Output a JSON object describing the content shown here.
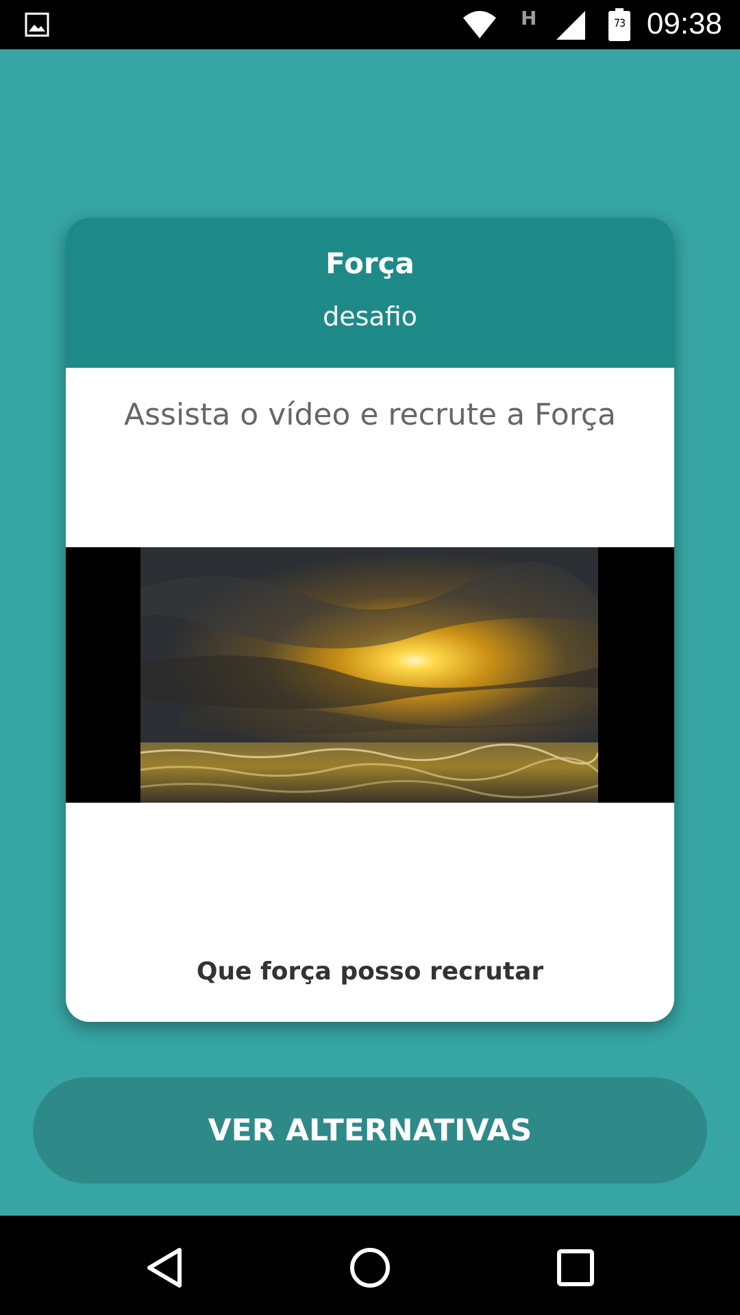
{
  "status_bar": {
    "time": "09:38",
    "battery_level": "73",
    "network_type": "H",
    "icons": [
      "gallery-icon",
      "wifi-icon",
      "cell-signal-icon",
      "battery-icon"
    ]
  },
  "card": {
    "title": "Força",
    "subtitle": "desafio",
    "instruction": "Assista o vídeo e recrute a Força",
    "question": "Que força posso recrutar",
    "video_thumbnail": "sunset-over-sea"
  },
  "actions": {
    "primary_button_label": "VER ALTERNATIVAS"
  },
  "nav_bar": {
    "icons": [
      "back-icon",
      "home-icon",
      "recent-apps-icon"
    ]
  },
  "colors": {
    "background": "#36a5a3",
    "card_header": "#1d8a88",
    "button": "#2e8a88"
  }
}
